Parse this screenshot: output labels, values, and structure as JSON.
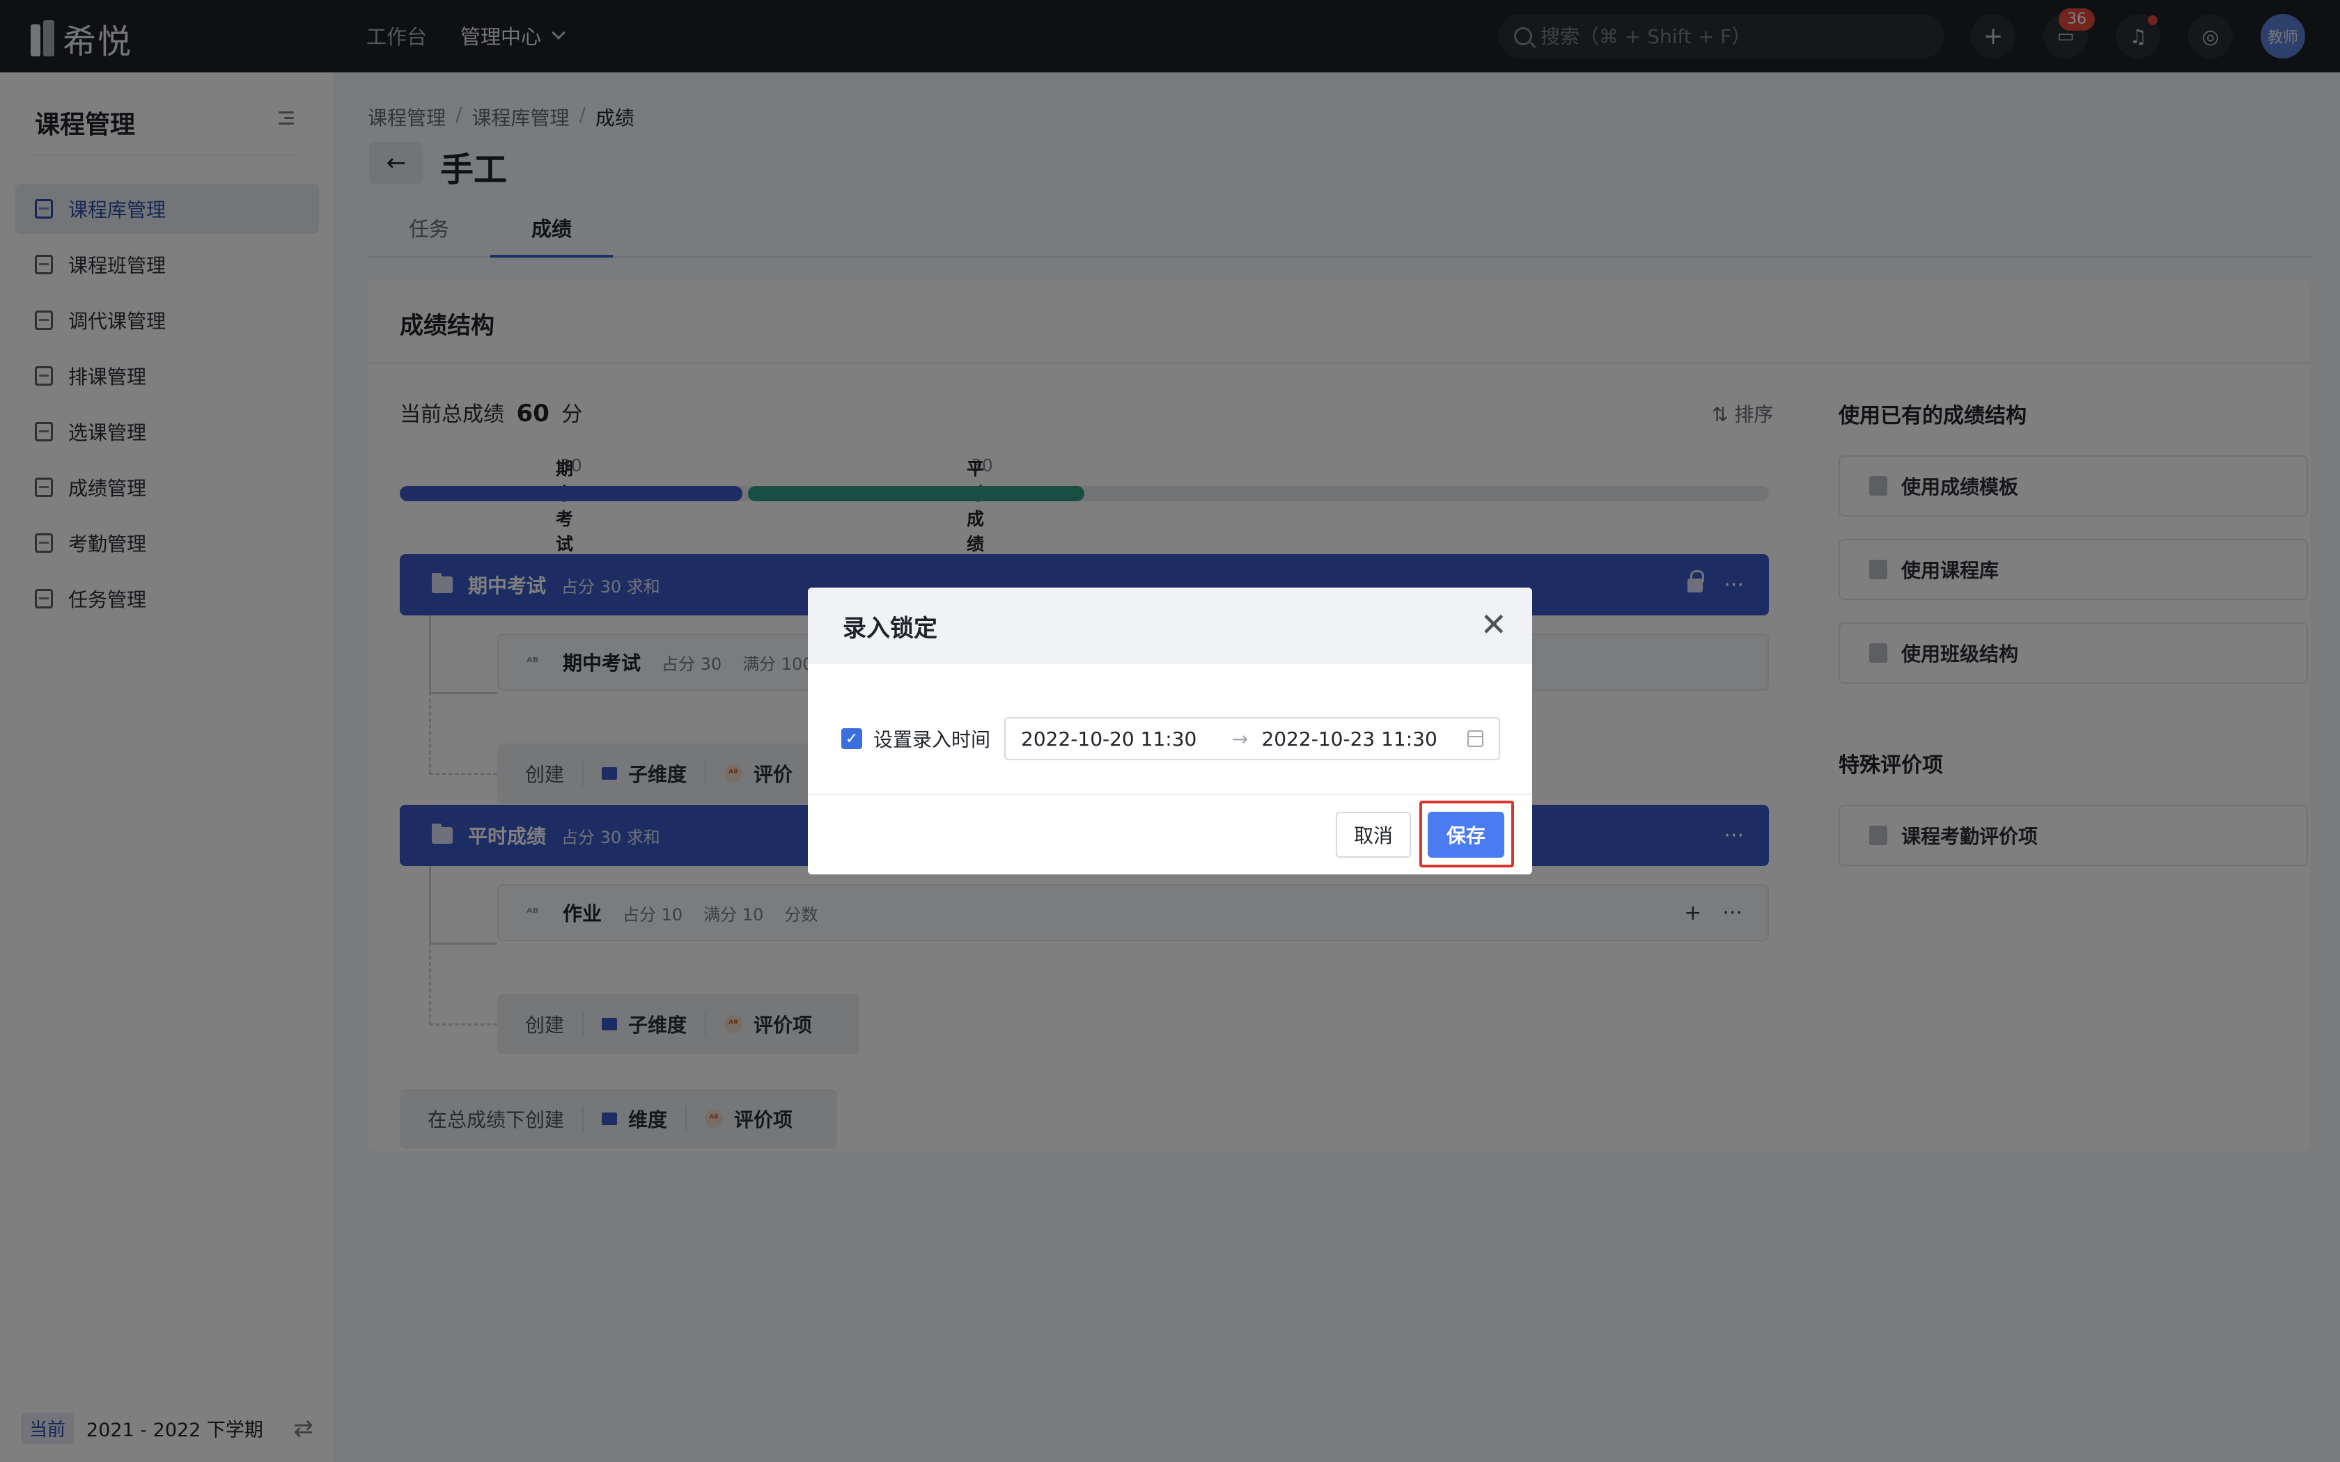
{
  "topbar": {
    "logo_text": "希悦",
    "nav": [
      "工作台",
      "管理中心"
    ],
    "search_placeholder": "搜索（⌘ + Shift + F）",
    "messages_badge": "36",
    "avatar_text": "教师"
  },
  "sidebar": {
    "title": "课程管理",
    "items": [
      {
        "label": "课程库管理"
      },
      {
        "label": "课程班管理"
      },
      {
        "label": "调代课管理"
      },
      {
        "label": "排课管理"
      },
      {
        "label": "选课管理"
      },
      {
        "label": "成绩管理"
      },
      {
        "label": "考勤管理"
      },
      {
        "label": "任务管理"
      }
    ],
    "term_tag": "当前",
    "term_text": "2021 - 2022 下学期"
  },
  "breadcrumb": [
    "课程管理",
    "课程库管理",
    "成绩"
  ],
  "page_title": "手工",
  "tabs": [
    "任务",
    "成绩"
  ],
  "card": {
    "title": "成绩结构",
    "total_prefix": "当前总成绩",
    "total_value": "60",
    "total_unit": "分",
    "sort_label": "排序",
    "progress": [
      {
        "label": "期中考试",
        "value": "30",
        "fraction": 0.25,
        "color": "#3a5bc6"
      },
      {
        "label": "平时成绩",
        "value": "30",
        "fraction": 0.25,
        "color": "#2f9e85"
      }
    ],
    "dimension1": {
      "name": "期中考试",
      "meta": "占分 30 求和"
    },
    "item1": {
      "name": "期中考试",
      "weight": "占分 30",
      "full": "满分 100"
    },
    "create_label": "创建",
    "sub_dim": "子维度",
    "eval_item": "评价项",
    "eval_item_partial": "评价",
    "dimension2": {
      "name": "平时成绩",
      "meta": "占分 30 求和"
    },
    "item2": {
      "name": "作业",
      "weight": "占分 10",
      "full": "满分 10",
      "type": "分数"
    },
    "root_create_label": "在总成绩下创建",
    "dimension": "维度"
  },
  "right": {
    "section1_title": "使用已有的成绩结构",
    "buttons": [
      "使用成绩模板",
      "使用课程库",
      "使用班级结构"
    ],
    "section2_title": "特殊评价项",
    "special": "课程考勤评价项"
  },
  "modal": {
    "title": "录入锁定",
    "checkbox_label": "设置录入时间",
    "start": "2022-10-20 11:30",
    "end": "2022-10-23 11:30",
    "cancel": "取消",
    "save": "保存"
  }
}
